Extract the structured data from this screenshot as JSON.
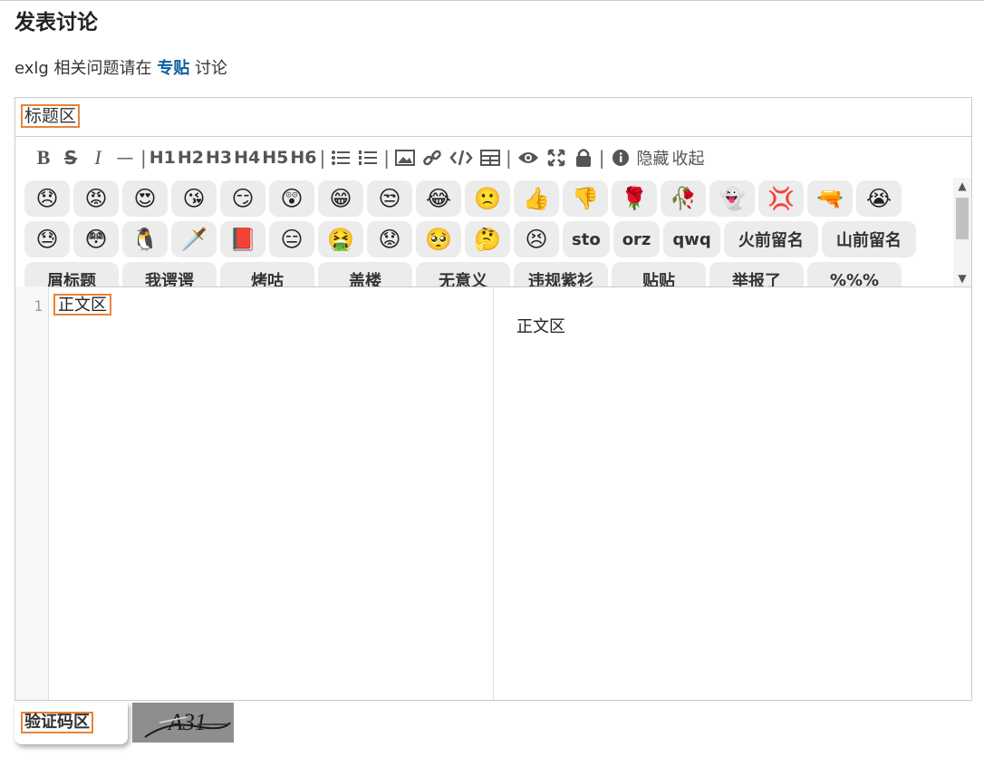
{
  "page": {
    "title": "发表讨论"
  },
  "intro": {
    "prefix": "exlg 相关问题请在",
    "link": "专贴",
    "suffix": "讨论"
  },
  "editor": {
    "title_value": "标题区",
    "toolbar": {
      "bold": "B",
      "strike": "S",
      "italic": "I",
      "hr": "—",
      "headings": [
        "H1",
        "H2",
        "H3",
        "H4",
        "H5",
        "H6"
      ],
      "separator": "|",
      "hide": "隐藏",
      "collapse": "收起",
      "icons": [
        "list-ul-icon",
        "list-ol-icon",
        "image-icon",
        "link-icon",
        "code-icon",
        "table-icon",
        "eye-icon",
        "fullscreen-icon",
        "lock-icon",
        "info-icon"
      ]
    },
    "stickers_row1": [
      "😞",
      "😡",
      "😍",
      "😘",
      "😏",
      "😲",
      "😁",
      "😒",
      "😂",
      "🙁",
      "👍",
      "👎",
      "🌹",
      "🥀",
      "👻",
      "💢",
      "🔫",
      "😭"
    ],
    "stickers_row2_emoji": [
      "😓",
      "😳",
      "🐧",
      "🗡️",
      "📕",
      "😑",
      "🤮",
      "😟",
      "🥺",
      "🤔",
      "😣"
    ],
    "stickers_row2_words": [
      "sto",
      "orz",
      "qwq",
      "火前留名",
      "山前留名"
    ],
    "stickers_row3": [
      "屑标题",
      "我谔谔",
      "烤咕",
      "盖楼",
      "无意义",
      "违规紫衫",
      "贴贴",
      "举报了",
      "%%%"
    ],
    "line_number": "1",
    "body_value": "正文区",
    "preview_text": "正文区"
  },
  "captcha": {
    "label": "验证码区",
    "image_text": "A31"
  },
  "colors": {
    "accent": "#e8833a",
    "link": "#0b5f9e"
  }
}
